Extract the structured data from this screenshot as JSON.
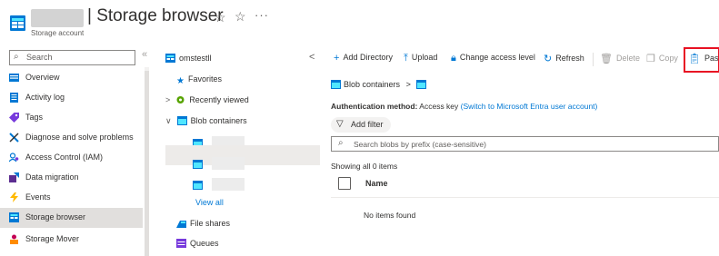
{
  "header": {
    "title": "| Storage browser",
    "subtitle": "Storage account",
    "more": "···"
  },
  "nav": {
    "search_placeholder": "Search",
    "collapse": "«",
    "items": [
      {
        "label": "Overview",
        "icon": "overview-icon",
        "color": "#0078d4"
      },
      {
        "label": "Activity log",
        "icon": "activity-log-icon",
        "color": "#0078d4"
      },
      {
        "label": "Tags",
        "icon": "tag-icon",
        "color": "#773adc"
      },
      {
        "label": "Diagnose and solve problems",
        "icon": "wrench-icon",
        "color": "#0078d4"
      },
      {
        "label": "Access Control (IAM)",
        "icon": "iam-icon",
        "color": "#0078d4"
      },
      {
        "label": "Data migration",
        "icon": "data-migration-icon",
        "color": "#5c2d91"
      },
      {
        "label": "Events",
        "icon": "lightning-icon",
        "color": "#ffb900"
      },
      {
        "label": "Storage browser",
        "icon": "storage-browser-icon",
        "color": "#0078d4",
        "selected": true
      },
      {
        "label": "Storage Mover",
        "icon": "storage-mover-icon",
        "color": "#c30052"
      }
    ]
  },
  "tree": {
    "account": "omstestll",
    "collapse": "<",
    "favorites": "Favorites",
    "recently_viewed": "Recently viewed",
    "blob_containers": "Blob containers",
    "expand_collapsed": ">",
    "expand_open": "∨",
    "view_all": "View all",
    "file_shares": "File shares",
    "queues": "Queues"
  },
  "toolbar": {
    "add_directory": "Add Directory",
    "upload": "Upload",
    "change_access": "Change access level",
    "refresh": "Refresh",
    "delete": "Delete",
    "copy": "Copy",
    "paste": "Paste"
  },
  "breadcrumb": {
    "root": "Blob containers",
    "sep": ">"
  },
  "auth": {
    "label": "Authentication method:",
    "value": "Access key",
    "switch_link": "(Switch to Microsoft Entra user account)"
  },
  "filter": {
    "label": "Add filter"
  },
  "blob_search": {
    "placeholder": "Search blobs by prefix (case-sensitive)"
  },
  "list": {
    "count": "Showing all 0 items",
    "col_name": "Name",
    "empty": "No items found"
  },
  "colors": {
    "accent": "#0078d4",
    "highlight": "#e81123",
    "selected_bg": "#e1dfdd"
  }
}
